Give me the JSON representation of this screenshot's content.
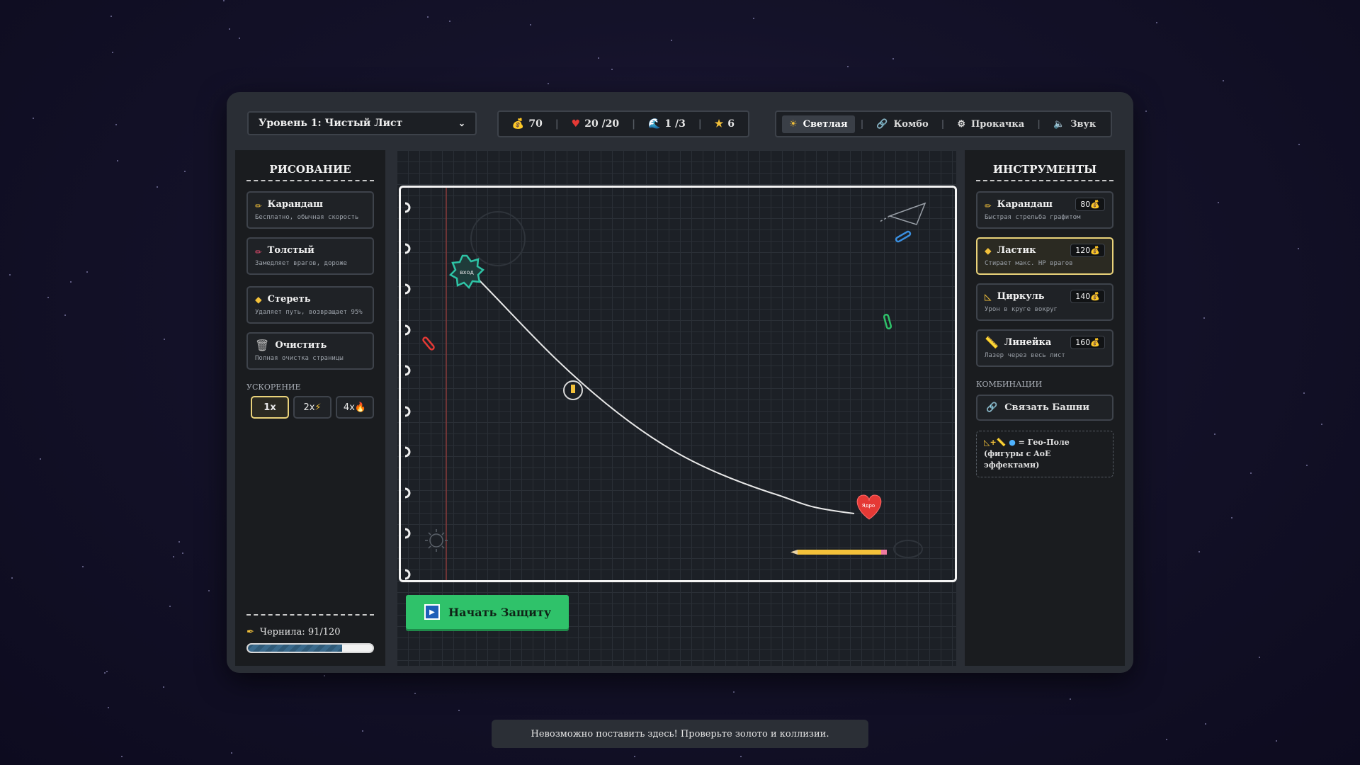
{
  "level_select": {
    "value": "Уровень 1: Чистый Лист"
  },
  "stats": {
    "gold": "70",
    "lives": "20 /20",
    "wave": "1 /3",
    "stars": "6"
  },
  "top_menu": {
    "theme": "Светлая",
    "combo": "Комбо",
    "upgrade": "Прокачка",
    "sound": "Звук"
  },
  "left_panel": {
    "title": "РИСОВАНИЕ",
    "tools": [
      {
        "name": "Карандаш",
        "desc": "Бесплатно, обычная скорость"
      },
      {
        "name": "Толстый",
        "desc": "Замедляет врагов, дороже"
      },
      {
        "name": "Стереть",
        "desc": "Удаляет путь, возвращает 95%"
      },
      {
        "name": "Очистить",
        "desc": "Полная очистка страницы"
      }
    ],
    "speed_label": "УСКОРЕНИЕ",
    "speeds": [
      "1x",
      "2x",
      "4x"
    ],
    "ink_label": "Чернила: 91/120",
    "ink_fraction": 0.758
  },
  "right_panel": {
    "title": "ИНСТРУМЕНТЫ",
    "towers": [
      {
        "name": "Карандаш",
        "desc": "Быстрая стрельба графитом",
        "cost": "80"
      },
      {
        "name": "Ластик",
        "desc": "Стирает макс. HP врагов",
        "cost": "120"
      },
      {
        "name": "Циркуль",
        "desc": "Урон в круге вокруг",
        "cost": "140"
      },
      {
        "name": "Линейка",
        "desc": "Лазер через весь лист",
        "cost": "160"
      }
    ],
    "combos_label": "КОМБИНАЦИИ",
    "combo_button": "Связать Башни",
    "combo_info": "= Гео-Поле (фигуры с AoE эффектами)"
  },
  "map": {
    "entry_label": "вход",
    "core_label": "Ядро"
  },
  "start_button": "Начать Защиту",
  "toast": "Невозможно поставить здесь! Проверьте золото и коллизии.",
  "colors": {
    "accent": "#e9d27a",
    "start": "#2fc26a",
    "entry": "#2ec4a6",
    "heart": "#e53935"
  }
}
